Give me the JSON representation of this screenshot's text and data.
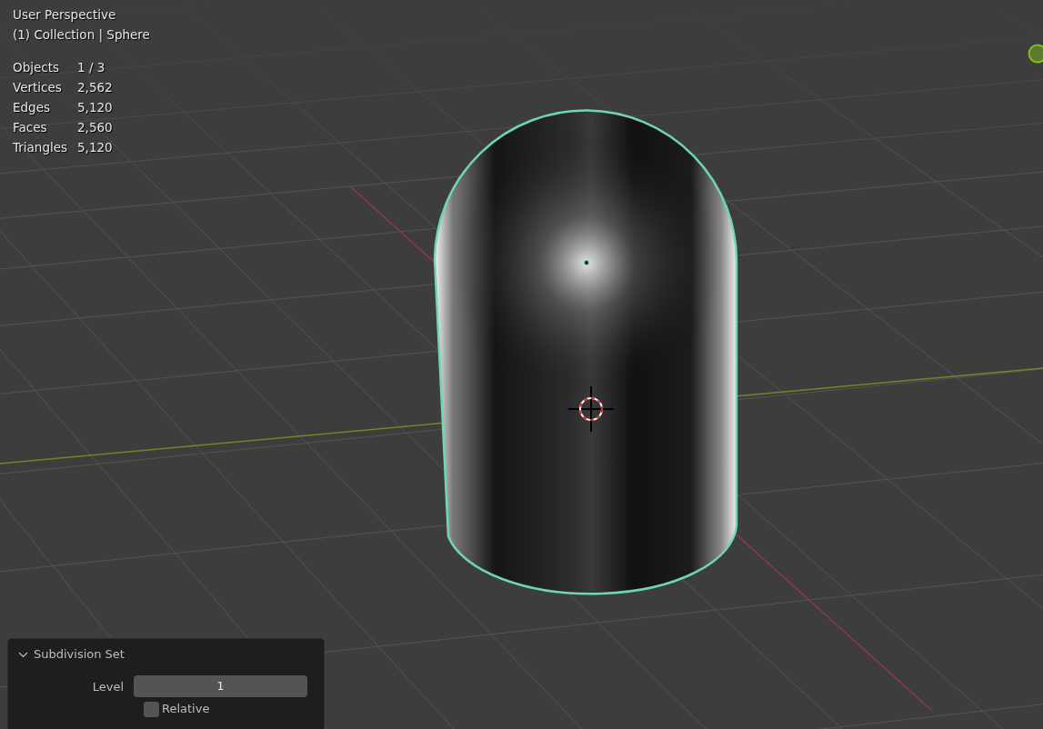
{
  "viewport": {
    "view_name": "User Perspective",
    "collection_label": "(1) Collection | Sphere"
  },
  "stats": [
    {
      "label": "Objects",
      "value": "1 / 3"
    },
    {
      "label": "Vertices",
      "value": "2,562"
    },
    {
      "label": "Edges",
      "value": "5,120"
    },
    {
      "label": "Faces",
      "value": "2,560"
    },
    {
      "label": "Triangles",
      "value": "5,120"
    }
  ],
  "operator_panel": {
    "title": "Subdivision Set",
    "expanded": true,
    "level_label": "Level",
    "level_value": "1",
    "relative": {
      "label": "Relative",
      "checked": false
    }
  }
}
